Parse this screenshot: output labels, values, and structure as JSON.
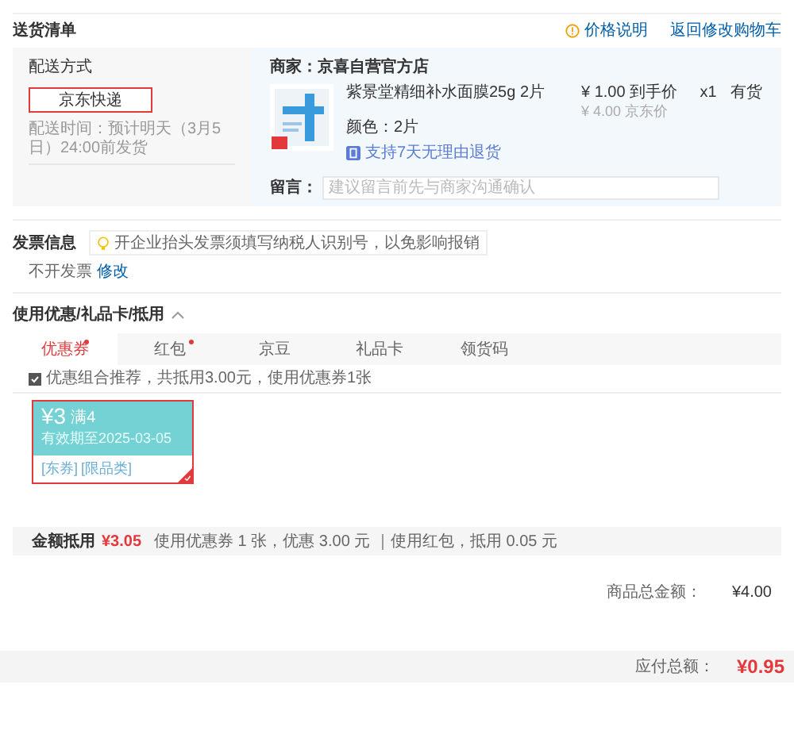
{
  "delivery_list": {
    "title": "送货清单",
    "price_note": "价格说明",
    "back_link": "返回修改购物车",
    "shipping": {
      "label": "配送方式",
      "method": "京东快递",
      "method_selected": true,
      "time": "配送时间：预计明天（3月5日）24:00前发货"
    },
    "shop": "商家：京喜自营官方店",
    "product": {
      "name": "紫景堂精细补水面膜25g 2片",
      "price": "¥ 1.00 到手价",
      "list_price": "¥ 4.00 京东价",
      "quantity": "x1",
      "stock": "有货",
      "variant": "颜色：2片",
      "return_policy": "支持7天无理由退货"
    },
    "note": {
      "label": "留言：",
      "placeholder": "建议留言前先与商家沟通确认"
    }
  },
  "invoice": {
    "title": "发票信息",
    "tip": "开企业抬头发票须填写纳税人识别号，以免影响报销",
    "status": "不开发票",
    "edit_link": "修改"
  },
  "discounts": {
    "title": "使用优惠/礼品卡/抵用",
    "expanded": true,
    "tabs": [
      {
        "label": "优惠券",
        "selected": true,
        "dot": true
      },
      {
        "label": "红包",
        "selected": false,
        "dot": true
      },
      {
        "label": "京豆",
        "selected": false,
        "dot": false
      },
      {
        "label": "礼品卡",
        "selected": false,
        "dot": false
      },
      {
        "label": "领货码",
        "selected": false,
        "dot": false
      }
    ],
    "recommend": {
      "label": "优惠组合推荐，共抵用3.00元，使用优惠券1张",
      "checked": true
    },
    "coupons": [
      {
        "amount": "¥3",
        "condition": "满4",
        "valid": "有效期至2025-03-05",
        "tags": [
          "[东券]",
          "[限品类]"
        ],
        "selected": true
      }
    ],
    "summary": {
      "label": "金额抵用",
      "amount": "¥3.05",
      "detail": "使用优惠券 1 张，优惠 3.00 元 ｜使用红包，抵用 0.05 元"
    }
  },
  "totals": {
    "rows": [
      {
        "label": "商品总金额：",
        "value": "¥4.00"
      }
    ],
    "payable_label": "应付总额：",
    "payable": "¥0.95"
  }
}
